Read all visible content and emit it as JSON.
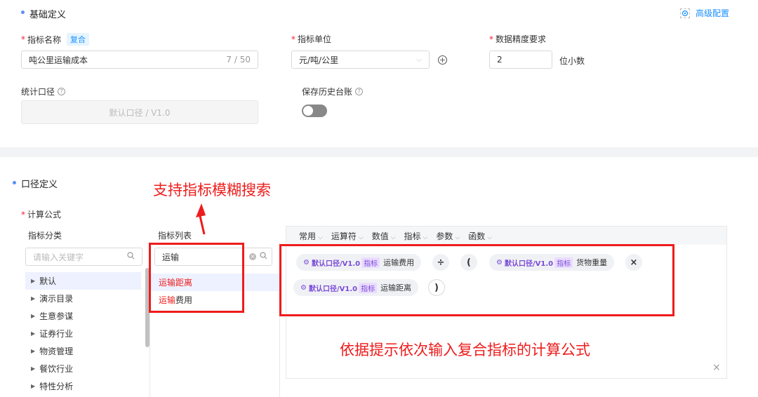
{
  "basic": {
    "section_title": "基础定义",
    "advanced_label": "高级配置",
    "name_label": "指标名称",
    "name_tag": "复合",
    "name_value": "吨公里运输成本",
    "name_count": "7 / 50",
    "unit_label": "指标单位",
    "unit_value": "元/吨/公里",
    "precision_label": "数据精度要求",
    "precision_value": "2",
    "precision_suffix": "位小数",
    "caliber_label": "统计口径",
    "caliber_value": "默认口径 / V1.0",
    "history_label": "保存历史台账",
    "history_enabled": false
  },
  "caliber_def": {
    "section_title": "口径定义",
    "formula_label": "计算公式",
    "category_header": "指标分类",
    "category_search_placeholder": "请输入关键字",
    "categories": [
      "默认",
      "演示目录",
      "生意参谋",
      "证券行业",
      "物资管理",
      "餐饮行业",
      "特性分析"
    ],
    "list_header": "指标列表",
    "list_search_value": "运输",
    "list_items": [
      {
        "match": "运输",
        "rest": "距离"
      },
      {
        "match": "运输",
        "rest": "费用"
      }
    ],
    "toolbar": [
      "常用",
      "运算符",
      "数值",
      "指标",
      "参数",
      "函数"
    ],
    "formula_tokens": {
      "version_label": "默认口径/V1.0",
      "badge_label": "指标",
      "item1": "运输费用",
      "op_divide": "÷",
      "paren_open": "(",
      "item2": "货物重量",
      "op_multiply": "×",
      "item3": "运输距离",
      "paren_close": ")"
    },
    "close_symbol": "×"
  },
  "annotations": {
    "search_note": "支持指标模糊搜索",
    "formula_note": "依据提示依次输入复合指标的计算公式"
  },
  "colors": {
    "accent": "#1890ff",
    "annotation": "#ee1c1c",
    "metric_purple": "#7a4bd8"
  }
}
